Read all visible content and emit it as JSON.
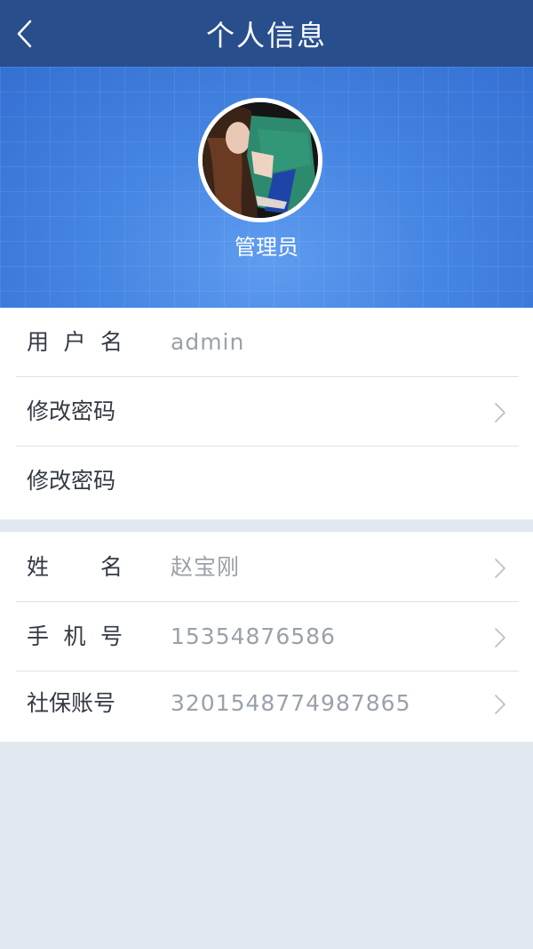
{
  "header": {
    "title": "个人信息",
    "back_icon": "chevron-left-icon"
  },
  "profile": {
    "role_name": "管理员",
    "avatar_alt": "avatar"
  },
  "section1": [
    {
      "label": "用户名",
      "value": "admin",
      "chevron": false
    },
    {
      "label": "修改密码",
      "value": "",
      "chevron": true
    },
    {
      "label": "修改密码",
      "value": "",
      "chevron": false
    }
  ],
  "section2": [
    {
      "label": "姓名",
      "value": "赵宝刚",
      "chevron": true
    },
    {
      "label": "手机号",
      "value": "15354876586",
      "chevron": true
    },
    {
      "label": "社保账号",
      "value": "3201548774987865",
      "chevron": true
    }
  ],
  "colors": {
    "nav_bg": "#284e8c",
    "hero_bg": "#4585e3",
    "page_bg": "#e2e8f0",
    "label_text": "#333a44",
    "value_text": "#9aa1aa"
  }
}
